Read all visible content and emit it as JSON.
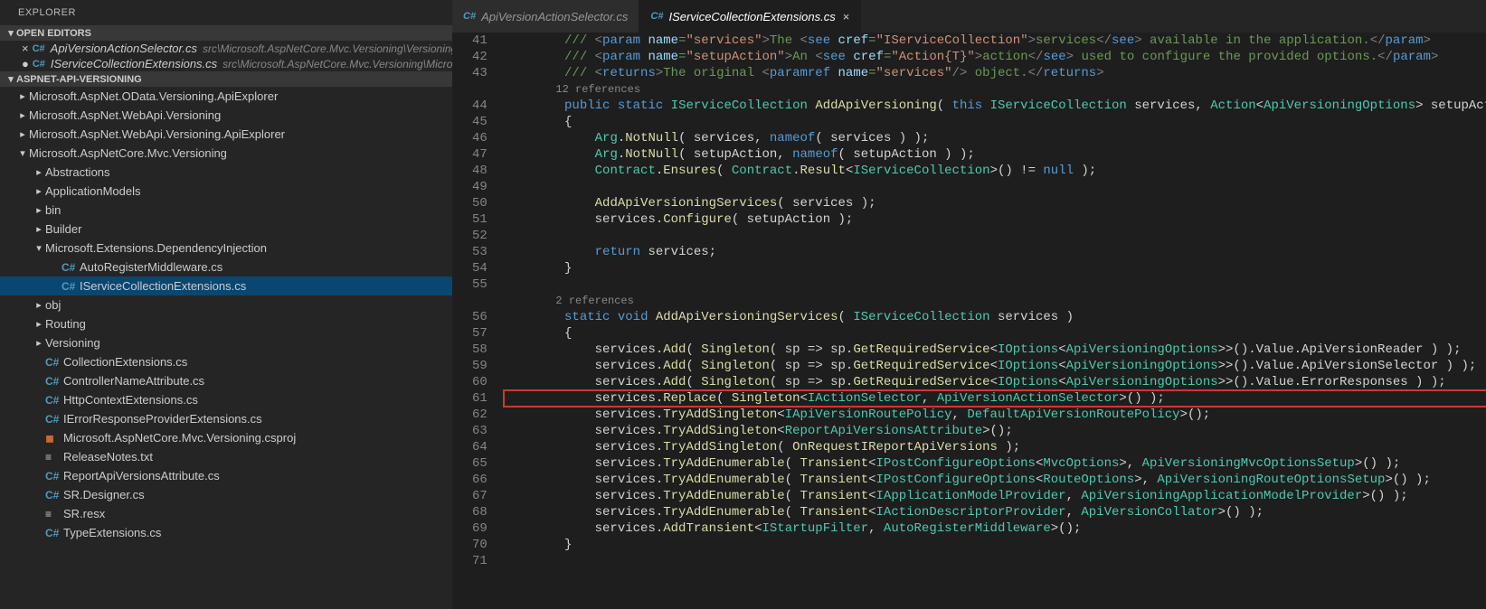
{
  "explorer": {
    "title": "EXPLORER"
  },
  "sections": {
    "open_editors": "OPEN EDITORS",
    "project": "ASPNET-API-VERSIONING"
  },
  "open_editors": [
    {
      "name": "ApiVersionActionSelector.cs",
      "path": "src\\Microsoft.AspNetCore.Mvc.Versioning\\Versioning",
      "modified": false
    },
    {
      "name": "IServiceCollectionExtensions.cs",
      "path": "src\\Microsoft.AspNetCore.Mvc.Versioning\\Microsoft.Ext...",
      "modified": true
    }
  ],
  "tree": [
    {
      "depth": 1,
      "tw": "▸",
      "label": "Microsoft.AspNet.OData.Versioning.ApiExplorer"
    },
    {
      "depth": 1,
      "tw": "▸",
      "label": "Microsoft.AspNet.WebApi.Versioning"
    },
    {
      "depth": 1,
      "tw": "▸",
      "label": "Microsoft.AspNet.WebApi.Versioning.ApiExplorer"
    },
    {
      "depth": 1,
      "tw": "▾",
      "label": "Microsoft.AspNetCore.Mvc.Versioning"
    },
    {
      "depth": 2,
      "tw": "▸",
      "label": "Abstractions"
    },
    {
      "depth": 2,
      "tw": "▸",
      "label": "ApplicationModels"
    },
    {
      "depth": 2,
      "tw": "▸",
      "label": "bin"
    },
    {
      "depth": 2,
      "tw": "▸",
      "label": "Builder"
    },
    {
      "depth": 2,
      "tw": "▾",
      "label": "Microsoft.Extensions.DependencyInjection"
    },
    {
      "depth": 3,
      "tw": "",
      "icon": "cs",
      "label": "AutoRegisterMiddleware.cs"
    },
    {
      "depth": 3,
      "tw": "",
      "icon": "cs",
      "label": "IServiceCollectionExtensions.cs",
      "sel": true
    },
    {
      "depth": 2,
      "tw": "▸",
      "label": "obj"
    },
    {
      "depth": 2,
      "tw": "▸",
      "label": "Routing"
    },
    {
      "depth": 2,
      "tw": "▸",
      "label": "Versioning"
    },
    {
      "depth": 2,
      "tw": "",
      "icon": "cs",
      "label": "CollectionExtensions.cs"
    },
    {
      "depth": 2,
      "tw": "",
      "icon": "cs",
      "label": "ControllerNameAttribute.cs"
    },
    {
      "depth": 2,
      "tw": "",
      "icon": "cs",
      "label": "HttpContextExtensions.cs"
    },
    {
      "depth": 2,
      "tw": "",
      "icon": "cs",
      "label": "IErrorResponseProviderExtensions.cs"
    },
    {
      "depth": 2,
      "tw": "",
      "icon": "rss",
      "label": "Microsoft.AspNetCore.Mvc.Versioning.csproj"
    },
    {
      "depth": 2,
      "tw": "",
      "icon": "txt",
      "label": "ReleaseNotes.txt"
    },
    {
      "depth": 2,
      "tw": "",
      "icon": "cs",
      "label": "ReportApiVersionsAttribute.cs"
    },
    {
      "depth": 2,
      "tw": "",
      "icon": "cs",
      "label": "SR.Designer.cs"
    },
    {
      "depth": 2,
      "tw": "",
      "icon": "txt",
      "label": "SR.resx"
    },
    {
      "depth": 2,
      "tw": "",
      "icon": "cs",
      "label": "TypeExtensions.cs"
    }
  ],
  "tabs": [
    {
      "label": "ApiVersionActionSelector.cs",
      "active": false
    },
    {
      "label": "IServiceCollectionExtensions.cs",
      "active": true
    }
  ],
  "code": {
    "refs1": "12 references",
    "refs2": "2 references",
    "lines": [
      {
        "n": 41,
        "html": "        <span class='cm'>/// <span class='xt'>&lt;</span><span class='kw'>param</span> <span class='xa'>name</span>=<span class='st'>\"services\"</span><span class='xt'>&gt;</span>The <span class='xt'>&lt;</span><span class='kw'>see</span> <span class='xa'>cref</span>=<span class='st'>\"IServiceCollection\"</span><span class='xt'>&gt;</span>services<span class='xt'>&lt;/</span><span class='kw'>see</span><span class='xt'>&gt;</span> available in the application.<span class='xt'>&lt;/</span><span class='kw'>param</span><span class='xt'>&gt;</span></span>"
      },
      {
        "n": 42,
        "html": "        <span class='cm'>/// <span class='xt'>&lt;</span><span class='kw'>param</span> <span class='xa'>name</span>=<span class='st'>\"setupAction\"</span><span class='xt'>&gt;</span>An <span class='xt'>&lt;</span><span class='kw'>see</span> <span class='xa'>cref</span>=<span class='st'>\"Action{T}\"</span><span class='xt'>&gt;</span>action<span class='xt'>&lt;/</span><span class='kw'>see</span><span class='xt'>&gt;</span> used to configure the provided options.<span class='xt'>&lt;/</span><span class='kw'>param</span><span class='xt'>&gt;</span></span>"
      },
      {
        "n": 43,
        "html": "        <span class='cm'>/// <span class='xt'>&lt;</span><span class='kw'>returns</span><span class='xt'>&gt;</span>The original <span class='xt'>&lt;</span><span class='kw'>paramref</span> <span class='xa'>name</span>=<span class='st'>\"services\"</span><span class='xt'>/&gt;</span> object.<span class='xt'>&lt;/</span><span class='kw'>returns</span><span class='xt'>&gt;</span></span>"
      },
      {
        "refs": 1
      },
      {
        "n": 44,
        "html": "        <span class='kw'>public</span> <span class='kw'>static</span> <span class='ty'>IServiceCollection</span> <span class='fn'>AddApiVersioning</span>( <span class='kw'>this</span> <span class='ty'>IServiceCollection</span> services, <span class='ty'>Action</span>&lt;<span class='ty'>ApiVersioningOptions</span>&gt; setupAction )"
      },
      {
        "n": 45,
        "html": "        {"
      },
      {
        "n": 46,
        "html": "            <span class='ty'>Arg</span>.<span class='fn'>NotNull</span>( services, <span class='kw'>nameof</span>( services ) );"
      },
      {
        "n": 47,
        "html": "            <span class='ty'>Arg</span>.<span class='fn'>NotNull</span>( setupAction, <span class='kw'>nameof</span>( setupAction ) );"
      },
      {
        "n": 48,
        "html": "            <span class='ty'>Contract</span>.<span class='fn'>Ensures</span>( <span class='ty'>Contract</span>.<span class='fn'>Result</span>&lt;<span class='ty'>IServiceCollection</span>&gt;() != <span class='nl'>null</span> );"
      },
      {
        "n": 49,
        "html": ""
      },
      {
        "n": 50,
        "html": "            <span class='fn'>AddApiVersioningServices</span>( services );"
      },
      {
        "n": 51,
        "html": "            services.<span class='fn'>Configure</span>( setupAction );"
      },
      {
        "n": 52,
        "html": ""
      },
      {
        "n": 53,
        "html": "            <span class='kw'>return</span> services;"
      },
      {
        "n": 54,
        "html": "        }"
      },
      {
        "n": 55,
        "html": ""
      },
      {
        "refs": 2
      },
      {
        "n": 56,
        "html": "        <span class='kw'>static</span> <span class='kw'>void</span> <span class='fn'>AddApiVersioningServices</span>( <span class='ty'>IServiceCollection</span> services )"
      },
      {
        "n": 57,
        "html": "        {"
      },
      {
        "n": 58,
        "html": "            services.<span class='fn'>Add</span>( <span class='fn'>Singleton</span>( sp =&gt; sp.<span class='fn'>GetRequiredService</span>&lt;<span class='ty'>IOptions</span>&lt;<span class='ty'>ApiVersioningOptions</span>&gt;&gt;().Value.ApiVersionReader ) );"
      },
      {
        "n": 59,
        "html": "            services.<span class='fn'>Add</span>( <span class='fn'>Singleton</span>( sp =&gt; sp.<span class='fn'>GetRequiredService</span>&lt;<span class='ty'>IOptions</span>&lt;<span class='ty'>ApiVersioningOptions</span>&gt;&gt;().Value.ApiVersionSelector ) );"
      },
      {
        "n": 60,
        "html": "            services.<span class='fn'>Add</span>( <span class='fn'>Singleton</span>( sp =&gt; sp.<span class='fn'>GetRequiredService</span>&lt;<span class='ty'>IOptions</span>&lt;<span class='ty'>ApiVersioningOptions</span>&gt;&gt;().Value.ErrorResponses ) );"
      },
      {
        "n": 61,
        "hl": true,
        "html": "            services.<span class='fn'>Replace</span>( <span class='fn'>Singleton</span>&lt;<span class='ty'>IActionSelector</span>, <span class='ty'>ApiVersionActionSelector</span>&gt;() );"
      },
      {
        "n": 62,
        "html": "            services.<span class='fn'>TryAddSingleton</span>&lt;<span class='ty'>IApiVersionRoutePolicy</span>, <span class='ty'>DefaultApiVersionRoutePolicy</span>&gt;();"
      },
      {
        "n": 63,
        "html": "            services.<span class='fn'>TryAddSingleton</span>&lt;<span class='ty'>ReportApiVersionsAttribute</span>&gt;();"
      },
      {
        "n": 64,
        "html": "            services.<span class='fn'>TryAddSingleton</span>( <span class='fn'>OnRequestIReportApiVersions</span> );"
      },
      {
        "n": 65,
        "html": "            services.<span class='fn'>TryAddEnumerable</span>( <span class='fn'>Transient</span>&lt;<span class='ty'>IPostConfigureOptions</span>&lt;<span class='ty'>MvcOptions</span>&gt;, <span class='ty'>ApiVersioningMvcOptionsSetup</span>&gt;() );"
      },
      {
        "n": 66,
        "html": "            services.<span class='fn'>TryAddEnumerable</span>( <span class='fn'>Transient</span>&lt;<span class='ty'>IPostConfigureOptions</span>&lt;<span class='ty'>RouteOptions</span>&gt;, <span class='ty'>ApiVersioningRouteOptionsSetup</span>&gt;() );"
      },
      {
        "n": 67,
        "html": "            services.<span class='fn'>TryAddEnumerable</span>( <span class='fn'>Transient</span>&lt;<span class='ty'>IApplicationModelProvider</span>, <span class='ty'>ApiVersioningApplicationModelProvider</span>&gt;() );"
      },
      {
        "n": 68,
        "html": "            services.<span class='fn'>TryAddEnumerable</span>( <span class='fn'>Transient</span>&lt;<span class='ty'>IActionDescriptorProvider</span>, <span class='ty'>ApiVersionCollator</span>&gt;() );"
      },
      {
        "n": 69,
        "html": "            services.<span class='fn'>AddTransient</span>&lt;<span class='ty'>IStartupFilter</span>, <span class='ty'>AutoRegisterMiddleware</span>&gt;();"
      },
      {
        "n": 70,
        "html": "        }"
      },
      {
        "n": 71,
        "html": ""
      }
    ]
  }
}
